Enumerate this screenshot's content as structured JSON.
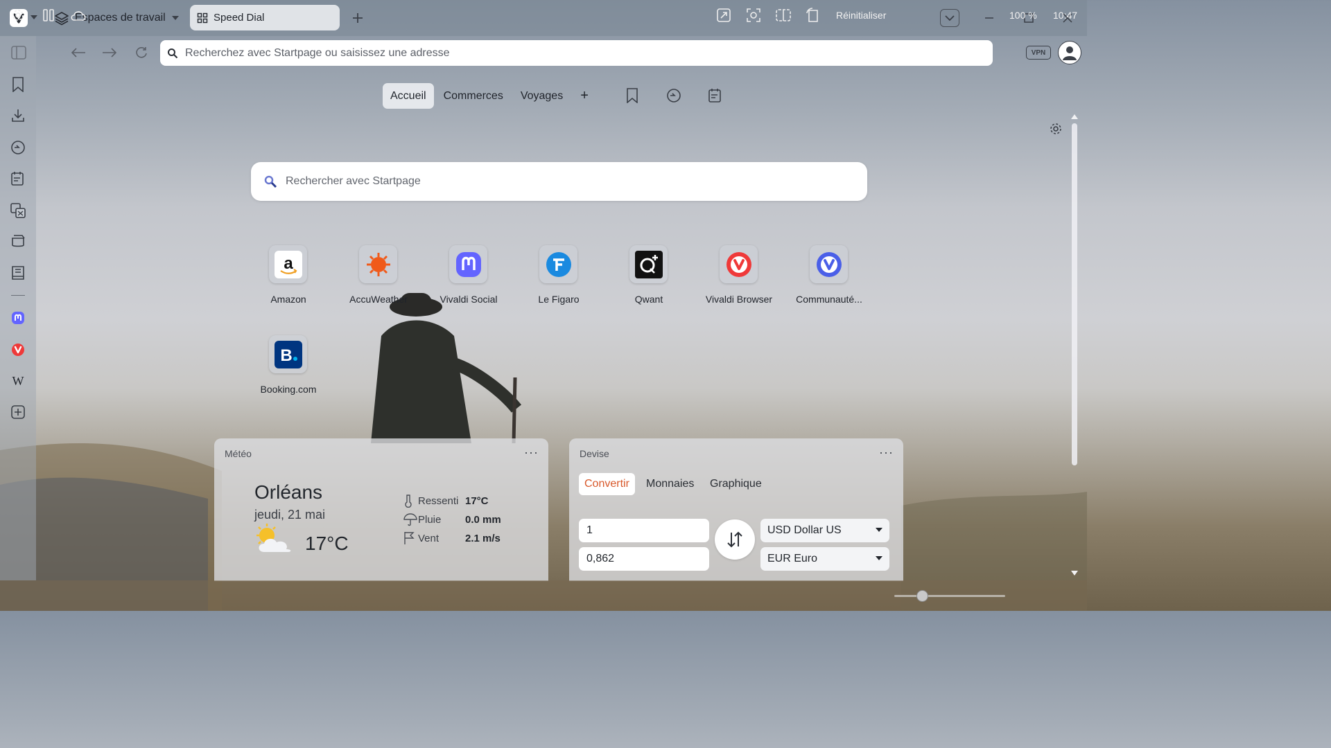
{
  "window": {
    "workspaces_label": "Espaces de travail",
    "tab_title": "Speed Dial"
  },
  "address_bar": {
    "placeholder": "Recherchez avec Startpage ou saisissez une adresse"
  },
  "speed_dial": {
    "tabs": [
      {
        "label": "Accueil"
      },
      {
        "label": "Commerces"
      },
      {
        "label": "Voyages"
      }
    ],
    "add_label": "+",
    "search_placeholder": "Rechercher avec Startpage",
    "tiles": [
      {
        "label": "Amazon",
        "icon": "amazon-icon"
      },
      {
        "label": "AccuWeather",
        "icon": "accuweather-icon"
      },
      {
        "label": "Vivaldi Social",
        "icon": "mastodon-icon"
      },
      {
        "label": "Le Figaro",
        "icon": "le-figaro-icon"
      },
      {
        "label": "Qwant",
        "icon": "qwant-icon"
      },
      {
        "label": "Vivaldi Browser",
        "icon": "vivaldi-icon"
      },
      {
        "label": "Communauté...",
        "icon": "vivaldi-community-icon"
      },
      {
        "label": "Booking.com",
        "icon": "booking-icon"
      }
    ]
  },
  "weather": {
    "title": "Météo",
    "menu": "···",
    "city": "Orléans",
    "date": "jeudi, 21 mai",
    "temperature": "17°C",
    "rows": [
      {
        "label": "Ressenti",
        "value": "17°C",
        "icon": "thermometer-icon"
      },
      {
        "label": "Pluie",
        "value": "0.0 mm",
        "icon": "umbrella-icon"
      },
      {
        "label": "Vent",
        "value": "2.1 m/s",
        "icon": "wind-flag-icon"
      }
    ]
  },
  "currency": {
    "title": "Devise",
    "menu": "···",
    "tabs": [
      {
        "label": "Convertir"
      },
      {
        "label": "Monnaies"
      },
      {
        "label": "Graphique"
      }
    ],
    "amount_from": "1",
    "amount_to": "0,862",
    "currency_from": "USD Dollar US",
    "currency_to": "EUR Euro"
  },
  "status_bar": {
    "reset_label": "Réinitialiser",
    "zoom": "100 %",
    "clock": "10:47",
    "zoom_slider_value": 0.25
  },
  "colors": {
    "vivaldi_red": "#ef3939",
    "mastodon_purple": "#6364ff",
    "accent_orange": "#d8582a"
  }
}
